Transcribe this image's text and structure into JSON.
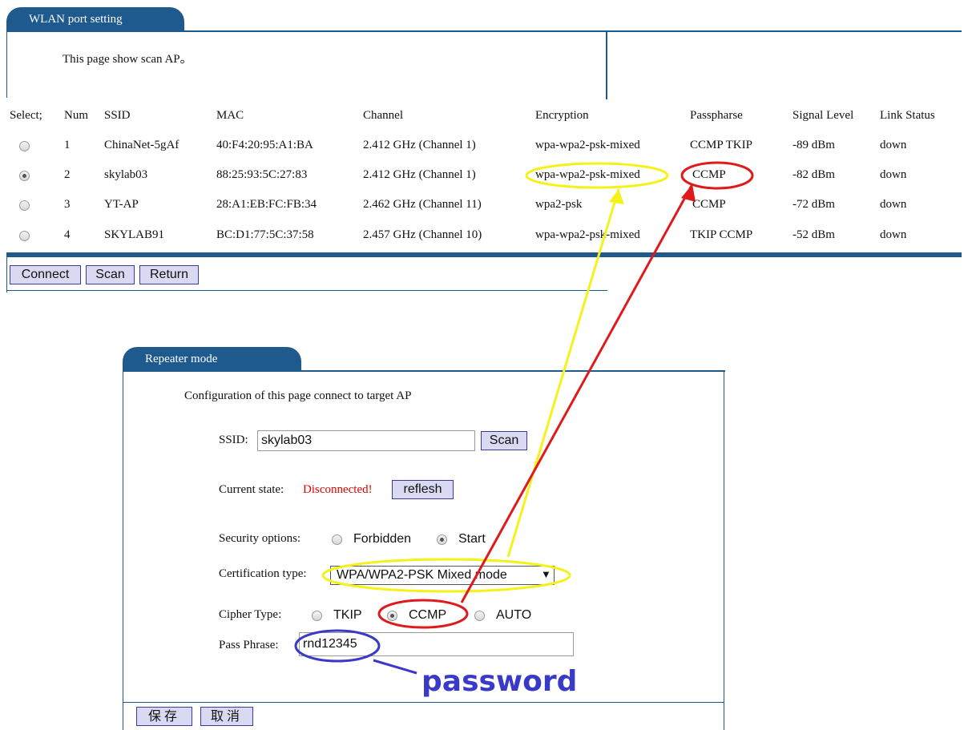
{
  "top_panel": {
    "tab_title": "WLAN port setting",
    "description": "This page show scan AP。",
    "columns": [
      "Select;",
      "Num",
      "SSID",
      "MAC",
      "Channel",
      "Encryption",
      "Passpharse",
      "Signal Level",
      "Link Status"
    ],
    "rows": [
      {
        "num": "1",
        "ssid": "ChinaNet-5gAf",
        "mac": "40:F4:20:95:A1:BA",
        "channel": "2.412 GHz (Channel 1)",
        "encryption": "wpa-wpa2-psk-mixed",
        "pass": "CCMP TKIP",
        "signal": "-89 dBm",
        "link": "down",
        "selected": false
      },
      {
        "num": "2",
        "ssid": "skylab03",
        "mac": "88:25:93:5C:27:83",
        "channel": "2.412 GHz (Channel 1)",
        "encryption": "wpa-wpa2-psk-mixed",
        "pass": "CCMP",
        "signal": "-82 dBm",
        "link": "down",
        "selected": true
      },
      {
        "num": "3",
        "ssid": "YT-AP",
        "mac": "28:A1:EB:FC:FB:34",
        "channel": "2.462 GHz (Channel 11)",
        "encryption": "wpa2-psk",
        "pass": "CCMP",
        "signal": "-72 dBm",
        "link": "down",
        "selected": false
      },
      {
        "num": "4",
        "ssid": "SKYLAB91",
        "mac": "BC:D1:77:5C:37:58",
        "channel": "2.457 GHz (Channel 10)",
        "encryption": "wpa-wpa2-psk-mixed",
        "pass": "TKIP CCMP",
        "signal": "-52 dBm",
        "link": "down",
        "selected": false
      }
    ],
    "buttons": {
      "connect": "Connect",
      "scan": "Scan",
      "return": "Return"
    }
  },
  "repeater": {
    "tab_title": "Repeater mode",
    "description": "Configuration of this page connect to target AP",
    "ssid_label": "SSID:",
    "ssid_value": "skylab03",
    "scan_button": "Scan",
    "state_label": "Current state:",
    "state_value": "Disconnected!",
    "reflesh_button": "reflesh",
    "security_label": "Security options:",
    "security_options": [
      "Forbidden",
      "Start"
    ],
    "security_selected": "Start",
    "cert_label": "Certification type:",
    "cert_value": "WPA/WPA2-PSK Mixed mode",
    "cipher_label": "Cipher Type:",
    "cipher_options": [
      "TKIP",
      "CCMP",
      "AUTO"
    ],
    "cipher_selected": "CCMP",
    "pass_label": "Pass Phrase:",
    "pass_value": "rnd12345",
    "save_button": "保存",
    "cancel_button": "取消"
  },
  "annotation": {
    "password_label": "password"
  },
  "colors": {
    "tab_blue": "#1e5a8e",
    "state_red": "#e00000",
    "highlight_yellow": "#f5f21a",
    "highlight_red": "#e01a1a",
    "highlight_blue": "#3a3ac8"
  }
}
